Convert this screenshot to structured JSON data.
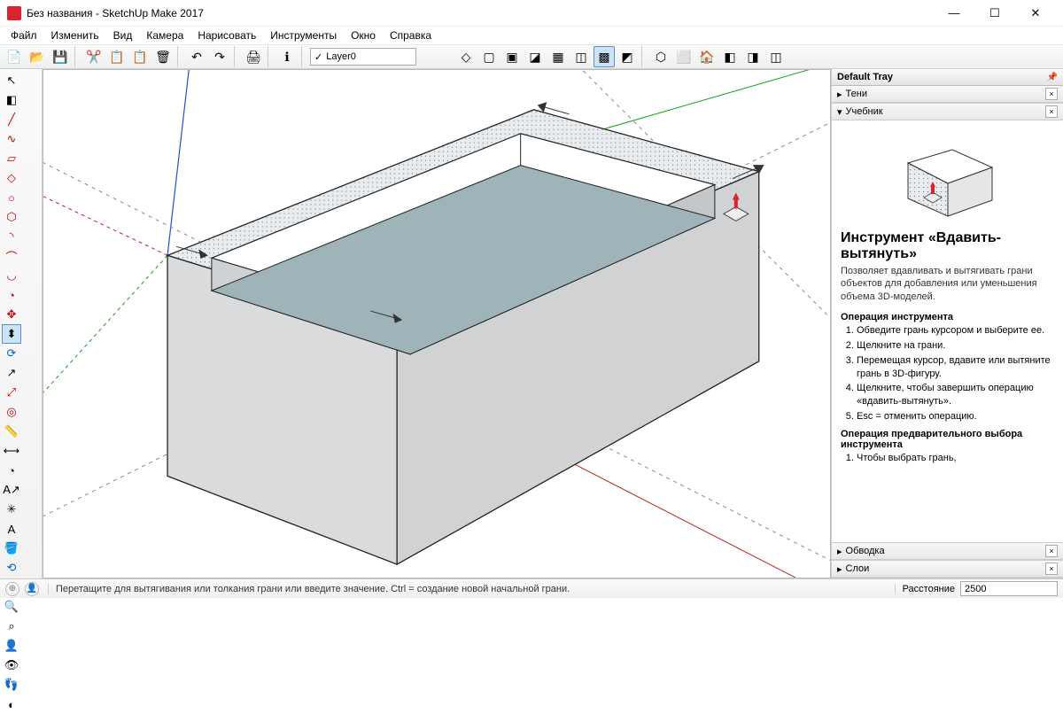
{
  "title": "Без названия - SketchUp Make 2017",
  "menu": [
    "Файл",
    "Изменить",
    "Вид",
    "Камера",
    "Нарисовать",
    "Инструменты",
    "Окно",
    "Справка"
  ],
  "layer_selected": "Layer0",
  "tray": {
    "title": "Default Tray",
    "panels": {
      "shadows": "Тени",
      "instructor": "Учебник",
      "outline": "Обводка",
      "layers": "Слои"
    }
  },
  "instructor": {
    "tool_title": "Инструмент «Вдавить-вытянуть»",
    "tool_desc": "Позволяет вдавливать и вытягивать грани объектов для добавления или уменьшения объема 3D-моделей.",
    "op_title": "Операция инструмента",
    "steps": [
      "Обведите грань курсором и выберите ее.",
      "Щелкните на грани.",
      "Перемещая курсор, вдавите или вытяните грань в 3D-фигуру.",
      "Щелкните, чтобы завершить операцию «вдавить-вытянуть».",
      "Esc = отменить операцию."
    ],
    "presel_title": "Операция предварительного выбора инструмента",
    "presel_step1": "Чтобы выбрать грань,"
  },
  "status": {
    "hint": "Перетащите для вытягивания или толкания грани или введите значение.  Ctrl = создание новой начальной грани.",
    "measure_label": "Расстояние",
    "measure_value": "2500"
  }
}
